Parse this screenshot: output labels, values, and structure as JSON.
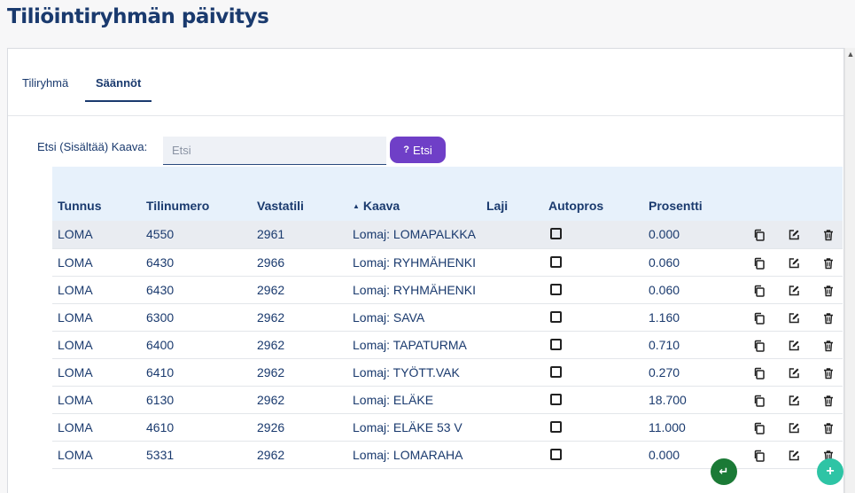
{
  "page": {
    "title": "Tiliöintiryhmän päivitys"
  },
  "tabs": [
    {
      "label": "Tiliryhmä"
    },
    {
      "label": "Säännöt"
    }
  ],
  "search": {
    "label": "Etsi (Sisältää) Kaava:",
    "placeholder": "Etsi",
    "button_label": "Etsi",
    "button_prefix": "?"
  },
  "table": {
    "columns": [
      "Tunnus",
      "Tilinumero",
      "Vastatili",
      "Kaava",
      "Laji",
      "Autopros",
      "Prosentti"
    ],
    "sort_indicator": "▲",
    "rows": [
      {
        "tunnus": "LOMA",
        "tilinumero": "4550",
        "vastatili": "2961",
        "kaava": "Lomaj: LOMAPALKKA",
        "laji": "",
        "prosentti": "0.000"
      },
      {
        "tunnus": "LOMA",
        "tilinumero": "6430",
        "vastatili": "2966",
        "kaava": "Lomaj: RYHMÄHENKI",
        "laji": "",
        "prosentti": "0.060"
      },
      {
        "tunnus": "LOMA",
        "tilinumero": "6430",
        "vastatili": "2962",
        "kaava": "Lomaj: RYHMÄHENKI",
        "laji": "",
        "prosentti": "0.060"
      },
      {
        "tunnus": "LOMA",
        "tilinumero": "6300",
        "vastatili": "2962",
        "kaava": "Lomaj: SAVA",
        "laji": "",
        "prosentti": "1.160"
      },
      {
        "tunnus": "LOMA",
        "tilinumero": "6400",
        "vastatili": "2962",
        "kaava": "Lomaj: TAPATURMA",
        "laji": "",
        "prosentti": "0.710"
      },
      {
        "tunnus": "LOMA",
        "tilinumero": "6410",
        "vastatili": "2962",
        "kaava": "Lomaj: TYÖTT.VAK",
        "laji": "",
        "prosentti": "0.270"
      },
      {
        "tunnus": "LOMA",
        "tilinumero": "6130",
        "vastatili": "2962",
        "kaava": "Lomaj: ELÄKE",
        "laji": "",
        "prosentti": "18.700"
      },
      {
        "tunnus": "LOMA",
        "tilinumero": "4610",
        "vastatili": "2926",
        "kaava": "Lomaj: ELÄKE 53 V",
        "laji": "",
        "prosentti": "11.000"
      },
      {
        "tunnus": "LOMA",
        "tilinumero": "5331",
        "vastatili": "2962",
        "kaava": "Lomaj: LOMARAHA",
        "laji": "",
        "prosentti": "0.000"
      }
    ]
  },
  "icons": {
    "copy": "copy-icon",
    "edit": "edit-icon",
    "delete": "trash-icon",
    "scroll_up": "▲"
  },
  "fabs": {
    "green_symbol": "↵",
    "add_symbol": "+"
  },
  "colors": {
    "primary": "#1a3a6e",
    "search_button": "#6f3fc7",
    "fab_green": "#1b7a36",
    "fab_teal": "#2ec4a5",
    "header_bg": "#e7f1fb"
  }
}
